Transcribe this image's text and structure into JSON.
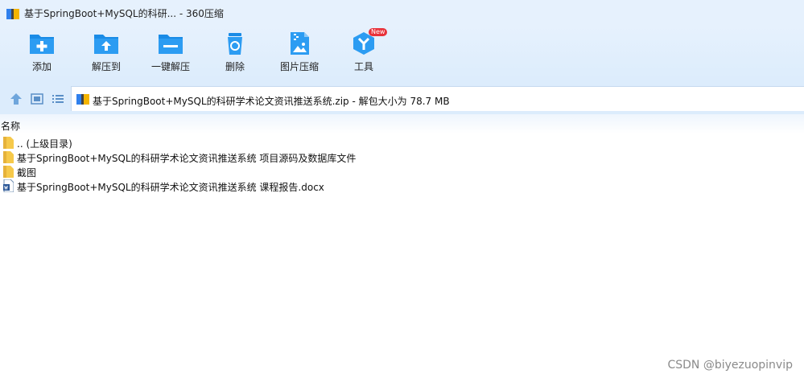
{
  "window": {
    "title": "基于SpringBoot+MySQL的科研... - 360压缩"
  },
  "toolbar": {
    "buttons": [
      {
        "label": "添加",
        "icon": "add-icon"
      },
      {
        "label": "解压到",
        "icon": "extract-to-icon"
      },
      {
        "label": "一键解压",
        "icon": "one-click-extract-icon"
      },
      {
        "label": "删除",
        "icon": "recycle-bin-icon"
      },
      {
        "label": "图片压缩",
        "icon": "image-compress-icon"
      },
      {
        "label": "工具",
        "icon": "tools-icon",
        "badge": "New"
      }
    ]
  },
  "address": {
    "text": "基于SpringBoot+MySQL的科研学术论文资讯推送系统.zip - 解包大小为 78.7 MB"
  },
  "list": {
    "column_header": "名称",
    "items": [
      {
        "name": ".. (上级目录)",
        "type": "folder"
      },
      {
        "name": "基于SpringBoot+MySQL的科研学术论文资讯推送系统 项目源码及数据库文件",
        "type": "folder"
      },
      {
        "name": "截图",
        "type": "folder"
      },
      {
        "name": "基于SpringBoot+MySQL的科研学术论文资讯推送系统 课程报告.docx",
        "type": "word-doc"
      }
    ]
  },
  "watermark": "CSDN @biyezuopinvip",
  "colors": {
    "accent": "#1a8be6",
    "toolbar_bg": "#dcecfc",
    "folder": "#f6c94a",
    "badge": "#e8313a"
  }
}
